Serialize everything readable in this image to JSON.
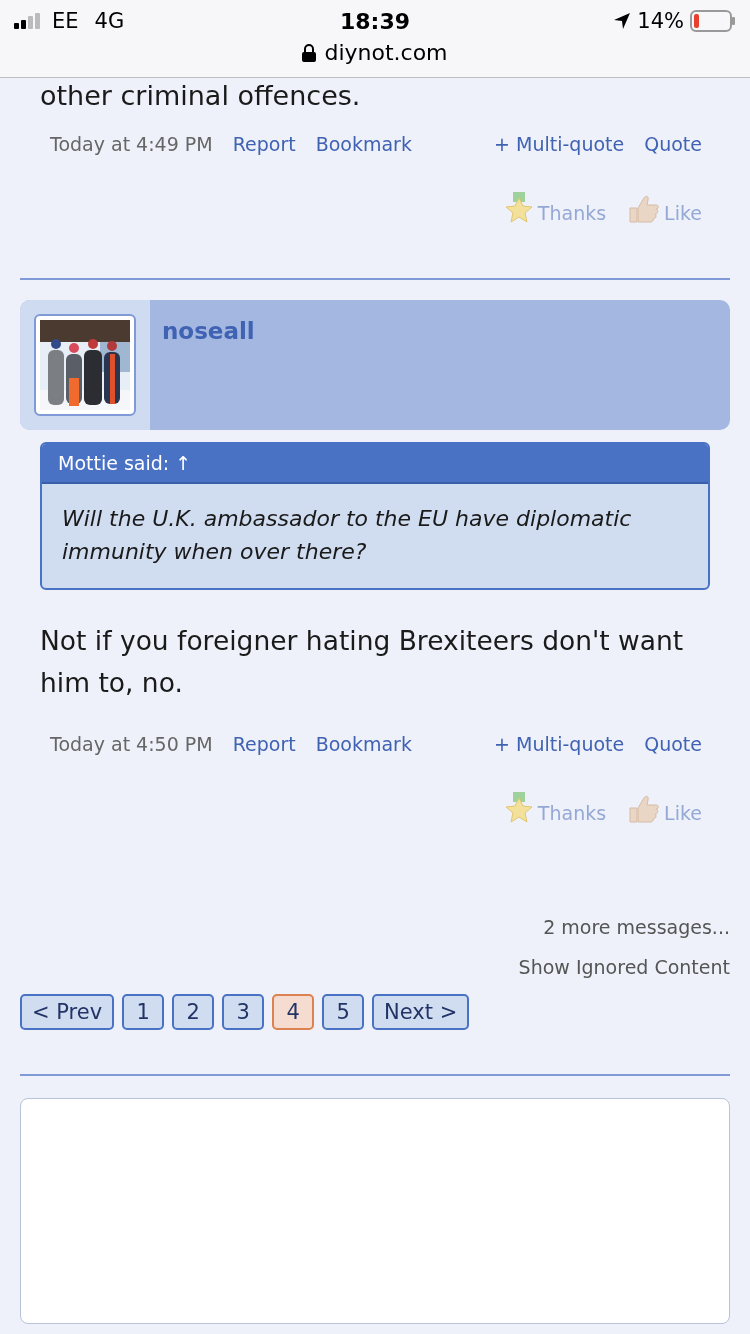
{
  "status_bar": {
    "carrier": "EE",
    "network": "4G",
    "time": "18:39",
    "battery": "14%"
  },
  "address_bar": {
    "url": "diynot.com"
  },
  "previous_post": {
    "text": "other criminal offences.",
    "footer": {
      "time": "Today at 4:49 PM",
      "links": [
        "Report",
        "Bookmark"
      ],
      "quote_links": [
        "+ Multi-quote",
        "Quote"
      ],
      "reactions": [
        {
          "kind": "thanks",
          "label": "Thanks"
        },
        {
          "kind": "like",
          "label": "Like"
        }
      ]
    }
  },
  "post": {
    "author": "noseall",
    "quote": {
      "header": "Mottie said: ↑",
      "text": "Will the U.K. ambassador to the EU have diplomatic immunity when over there?"
    },
    "text": "Not if you foreigner hating Brexiteers don't want him to, no.",
    "footer": {
      "time": "Today at 4:50 PM",
      "links": [
        "Report",
        "Bookmark"
      ],
      "quote_links": [
        "+ Multi-quote",
        "Quote"
      ],
      "reactions": [
        {
          "kind": "thanks",
          "label": "Thanks"
        },
        {
          "kind": "like",
          "label": "Like"
        }
      ]
    }
  },
  "more_messages": "2 more messages...",
  "show_ignored": "Show Ignored Content",
  "pagination": {
    "prev": "< Prev",
    "pages": [
      {
        "label": "1",
        "selected": false
      },
      {
        "label": "2",
        "selected": false
      },
      {
        "label": "3",
        "selected": false
      },
      {
        "label": "4",
        "selected": true
      },
      {
        "label": "5",
        "selected": false
      }
    ],
    "next": "Next >"
  }
}
